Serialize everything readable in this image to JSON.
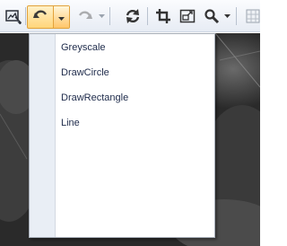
{
  "toolbar": {
    "icons": [
      "image-icon",
      "undo-icon",
      "dropdown-arrow",
      "redo-icon",
      "dropdown-arrow",
      "refresh-icon",
      "crop-icon",
      "fit-icon",
      "zoom-icon",
      "dropdown-arrow",
      "grid-icon"
    ],
    "undo_active_color": "#ffd57a"
  },
  "menu": {
    "items": [
      {
        "label": "Greyscale"
      },
      {
        "label": "DrawCircle"
      },
      {
        "label": "DrawRectangle"
      },
      {
        "label": "Line"
      }
    ]
  }
}
